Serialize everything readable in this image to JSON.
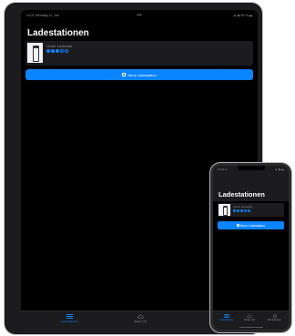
{
  "ipad": {
    "status": {
      "time": "10:21",
      "date": "Dienstag 11. Juli",
      "center": "•••",
      "battery": "▲ ◉ 50 % ▬"
    },
    "title": "Ladestationen",
    "station": {
      "name": "Unser Ladestati",
      "dots": [
        "on",
        "on",
        "on",
        "off",
        "off"
      ]
    },
    "add_button": "Neue Ladestation",
    "tabs": [
      {
        "label": "Ladestationen",
        "icon": "list-icon",
        "active": true
      },
      {
        "label": "Wetter Uhr",
        "icon": "cloud-icon",
        "active": false
      }
    ]
  },
  "iphone": {
    "status": {
      "time": "10:21 ◂",
      "battery": "▲ ◉ ▬"
    },
    "title": "Ladestationen",
    "station": {
      "name": "Unser Ladestati",
      "dots": [
        "on",
        "on",
        "on",
        "off",
        "off"
      ]
    },
    "add_button": "Neue Ladestation",
    "tabs": [
      {
        "label": "Ladestationen",
        "icon": "list-icon",
        "active": true
      },
      {
        "label": "Wetter Uhr",
        "icon": "cloud-icon",
        "active": false
      },
      {
        "label": "Einstellungen",
        "icon": "gear-icon",
        "active": false
      }
    ]
  },
  "colors": {
    "accent": "#0a84ff",
    "background": "#000000",
    "surface": "#1c1c1e",
    "secondary_text": "#8e8e93"
  }
}
